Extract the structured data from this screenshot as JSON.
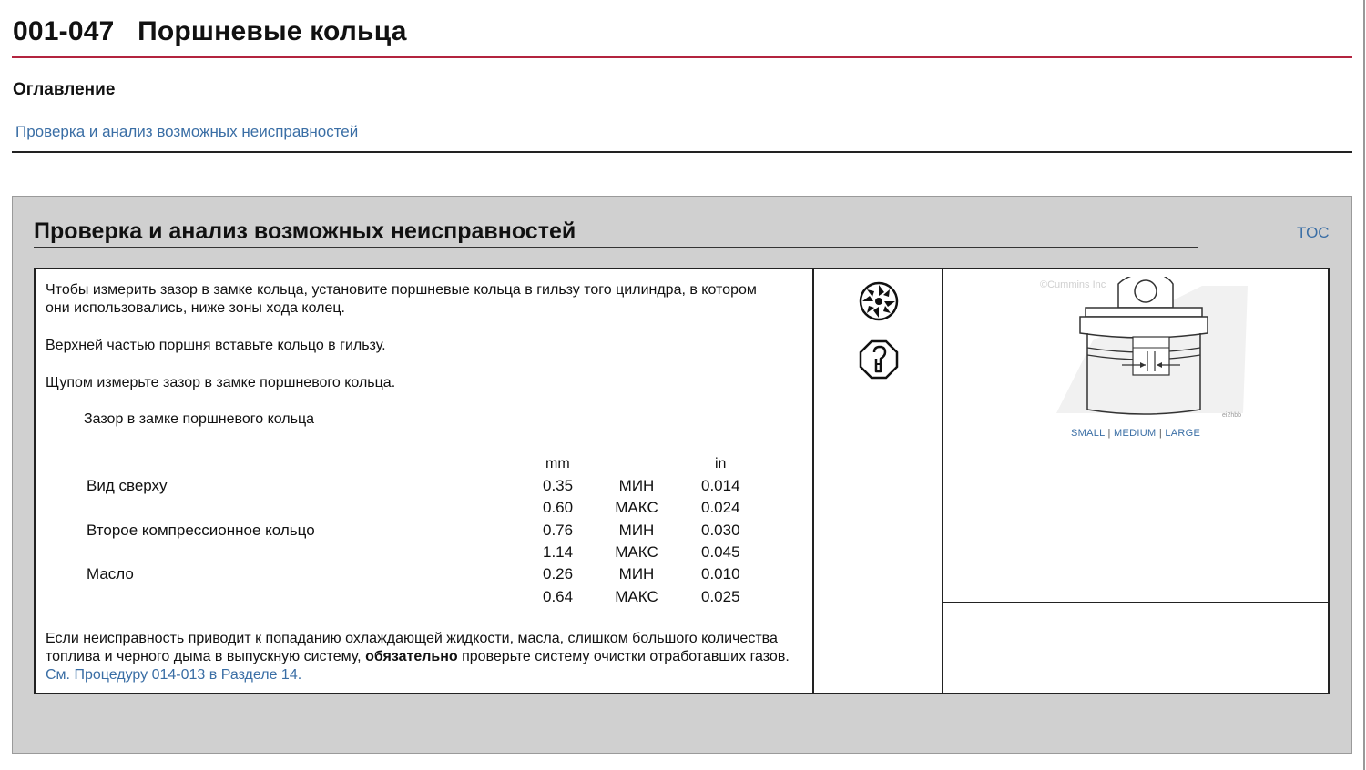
{
  "header": {
    "title": "001-047   Поршневые кольца"
  },
  "toc": {
    "heading": "Оглавление",
    "link": "Проверка и анализ возможных неисправностей"
  },
  "section": {
    "title": "Проверка и анализ возможных неисправностей",
    "toc_link": "TOC",
    "paragraphs": [
      "Чтобы измерить зазор в замке кольца, установите поршневые кольца в гильзу того цилиндра, в котором они использовались, ниже зоны хода колец.",
      "Верхней частью поршня вставьте кольцо в гильзу.",
      "Щупом измерьте зазор в замке поршневого кольца."
    ],
    "spec": {
      "title": "Зазор в замке поршневого кольца",
      "unit_mm": "mm",
      "unit_in": "in",
      "rows": [
        {
          "label": "Вид сверху",
          "mm": "0.35",
          "limit": "МИН",
          "in": "0.014"
        },
        {
          "label": "",
          "mm": "0.60",
          "limit": "МАКС",
          "in": "0.024"
        },
        {
          "label": "Второе компрессионное кольцо",
          "mm": "0.76",
          "limit": "МИН",
          "in": "0.030"
        },
        {
          "label": "",
          "mm": "1.14",
          "limit": "МАКС",
          "in": "0.045"
        },
        {
          "label": "Масло",
          "mm": "0.26",
          "limit": "МИН",
          "in": "0.010"
        },
        {
          "label": "",
          "mm": "0.64",
          "limit": "МАКС",
          "in": "0.025"
        }
      ]
    },
    "note": {
      "pre": "Если неисправность приводит к попаданию охлаждающей жидкости, масла, слишком большого количества топлива и черного дыма в выпускную систему, ",
      "bold": "обязательно",
      "post": " проверьте систему очистки отработавших газов. ",
      "link": "См. Процедуру 014-013 в Разделе 14."
    },
    "icons": [
      "parts-wheel-icon",
      "feeler-gauge-icon"
    ],
    "image": {
      "watermark": "©Cummins Inc",
      "code": "ei2hbb",
      "sizes": [
        "SMALL",
        "MEDIUM",
        "LARGE"
      ]
    }
  },
  "colors": {
    "accent_rule": "#b3243f",
    "link": "#3a6ea5",
    "panel": "#d0d0d0"
  }
}
